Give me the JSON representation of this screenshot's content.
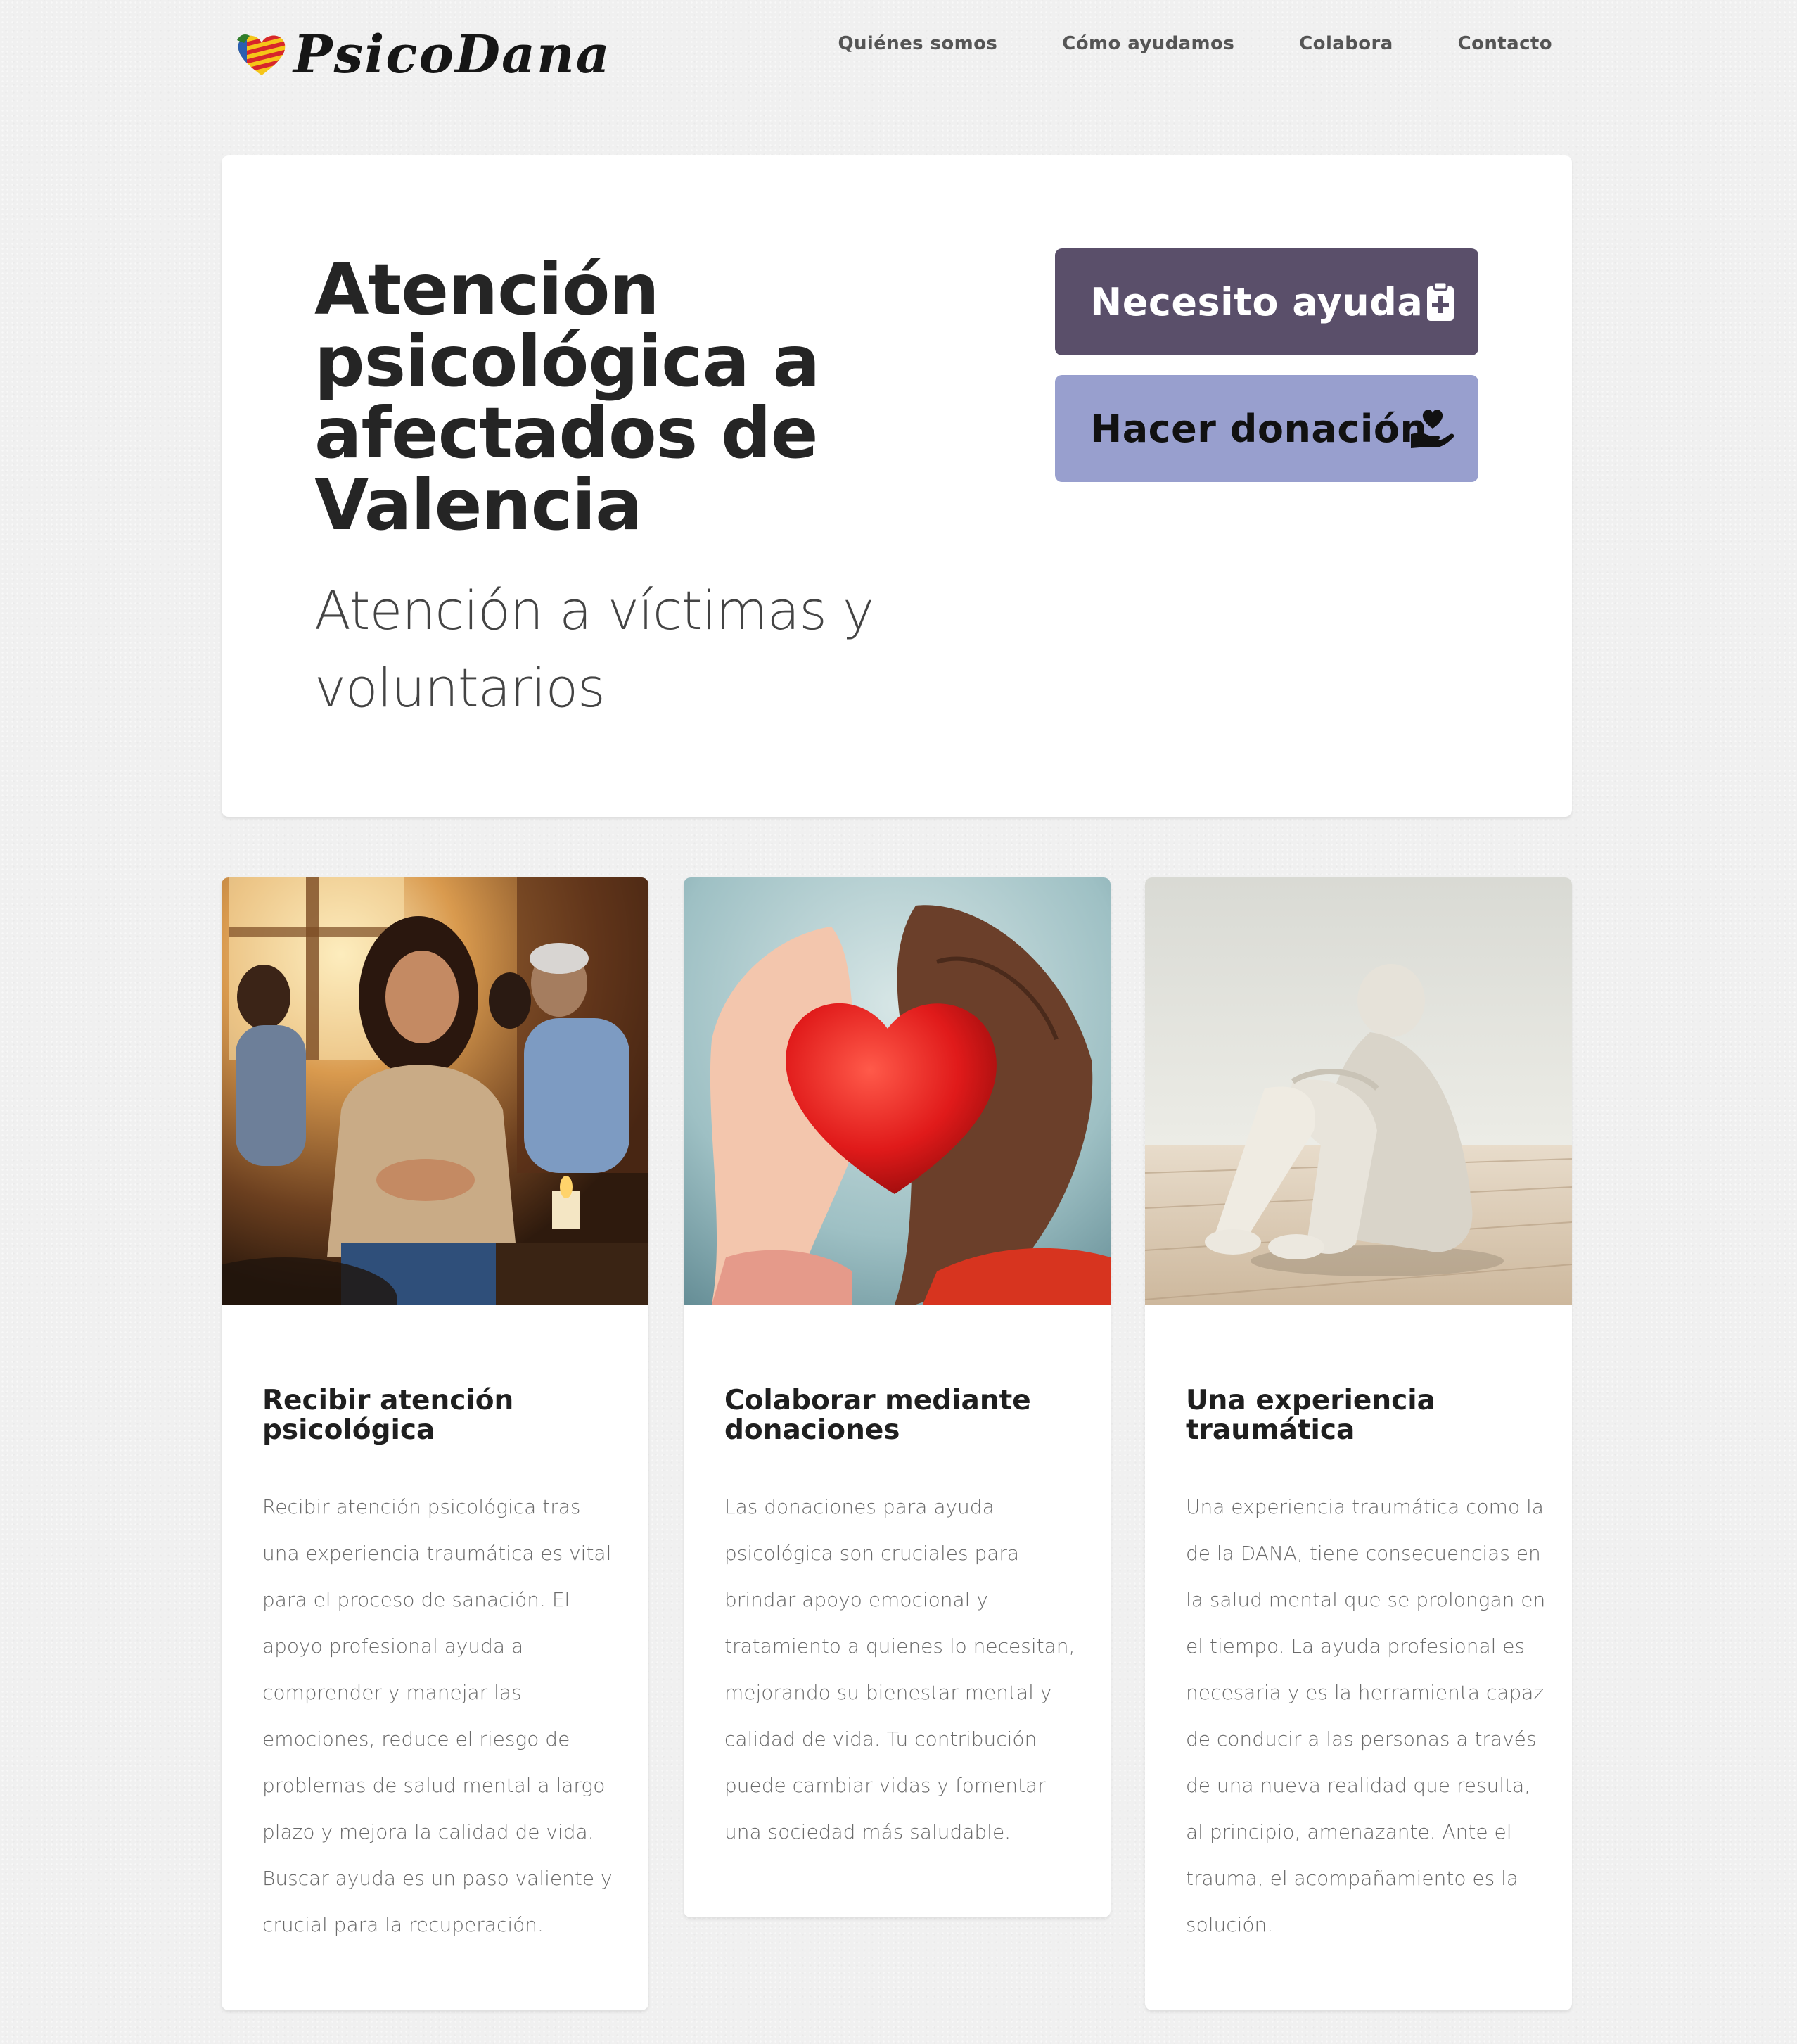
{
  "brand": {
    "name": "PsicoDana",
    "colors": {
      "stripe_red": "#d7262b",
      "stripe_yellow": "#f5c518",
      "leaf": "#2f7d2a"
    }
  },
  "nav": {
    "items": [
      {
        "label": "Quiénes somos"
      },
      {
        "label": "Cómo ayudamos"
      },
      {
        "label": "Colabora"
      },
      {
        "label": "Contacto"
      }
    ]
  },
  "hero": {
    "title": "Atención psicológica a afectados de Valencia",
    "subtitle": "Atención a víctimas y voluntarios",
    "buttons": {
      "help": {
        "label": "Necesito ayuda",
        "icon": "clipboard-medical-icon",
        "color": "#5a4f6a"
      },
      "donate": {
        "label": "Hacer donación",
        "icon": "hand-holding-heart-icon",
        "color": "#989fce"
      }
    }
  },
  "cards": [
    {
      "image": "group-therapy-photo",
      "title": "Recibir atención psicológica",
      "text": "Recibir atención psicológica tras una experiencia traumática es vital para el proceso de sanación. El apoyo profesional ayuda a comprender y manejar las emociones, reduce el riesgo de problemas de salud mental a largo plazo y mejora la calidad de vida. Buscar ayuda es un paso valiente y crucial para la recuperación."
    },
    {
      "image": "hands-holding-heart-photo",
      "title": "Colaborar mediante donaciones",
      "text": "Las donaciones para ayuda psicológica son cruciales para brindar apoyo emocional y tratamiento a quienes lo necesitan, mejorando su bienestar mental y calidad de vida. Tu contribución puede cambiar vidas y fomentar una sociedad más saludable."
    },
    {
      "image": "sitting-figure-photo",
      "title": "Una experiencia traumática",
      "text": "Una experiencia traumática como la de la DANA, tiene consecuencias en la salud mental que se prolongan en el tiempo. La ayuda profesional es necesaria y es la herramienta capaz de conducir a las personas a través de una nueva realidad que resulta, al principio, amenazante. Ante el trauma, el acompañamiento es la solución."
    }
  ]
}
